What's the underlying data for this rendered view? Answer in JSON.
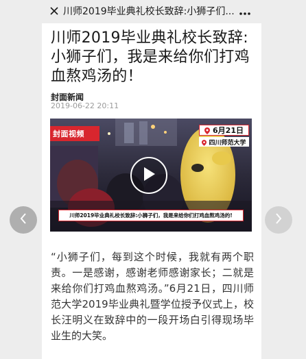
{
  "topbar": {
    "title": "川师2019毕业典礼校长致辞:小狮子们...",
    "close_icon": "close-icon",
    "more_icon": "more-icon"
  },
  "article": {
    "title": "川师2019毕业典礼校长致辞:小狮子们，我是来给你们打鸡血熬鸡汤的！",
    "source": "封面新闻",
    "date": "2019-06-22 20:11",
    "body": "“小狮子们，每到这个时候，我就有两个职责。一是感谢，感谢老师感谢家长；二就是来给你们打鸡血熬鸡汤。”6月21日，四川师范大学2019毕业典礼暨学位授予仪式上，校长汪明义在致辞中的一段开场白引得现场毕业生的大笑。"
  },
  "video": {
    "logo_text": "封面视频",
    "date_tag": "6月21日",
    "school_tag": "四川师范大学",
    "caption": "川师2019毕业典礼校长致辞:小狮子们，我是来给你们打鸡血熬鸡汤的!",
    "play_icon": "play-icon",
    "brand_color": "#d8262e"
  },
  "navigation": {
    "prev_icon": "chevron-left-icon",
    "next_icon": "chevron-right-icon"
  }
}
